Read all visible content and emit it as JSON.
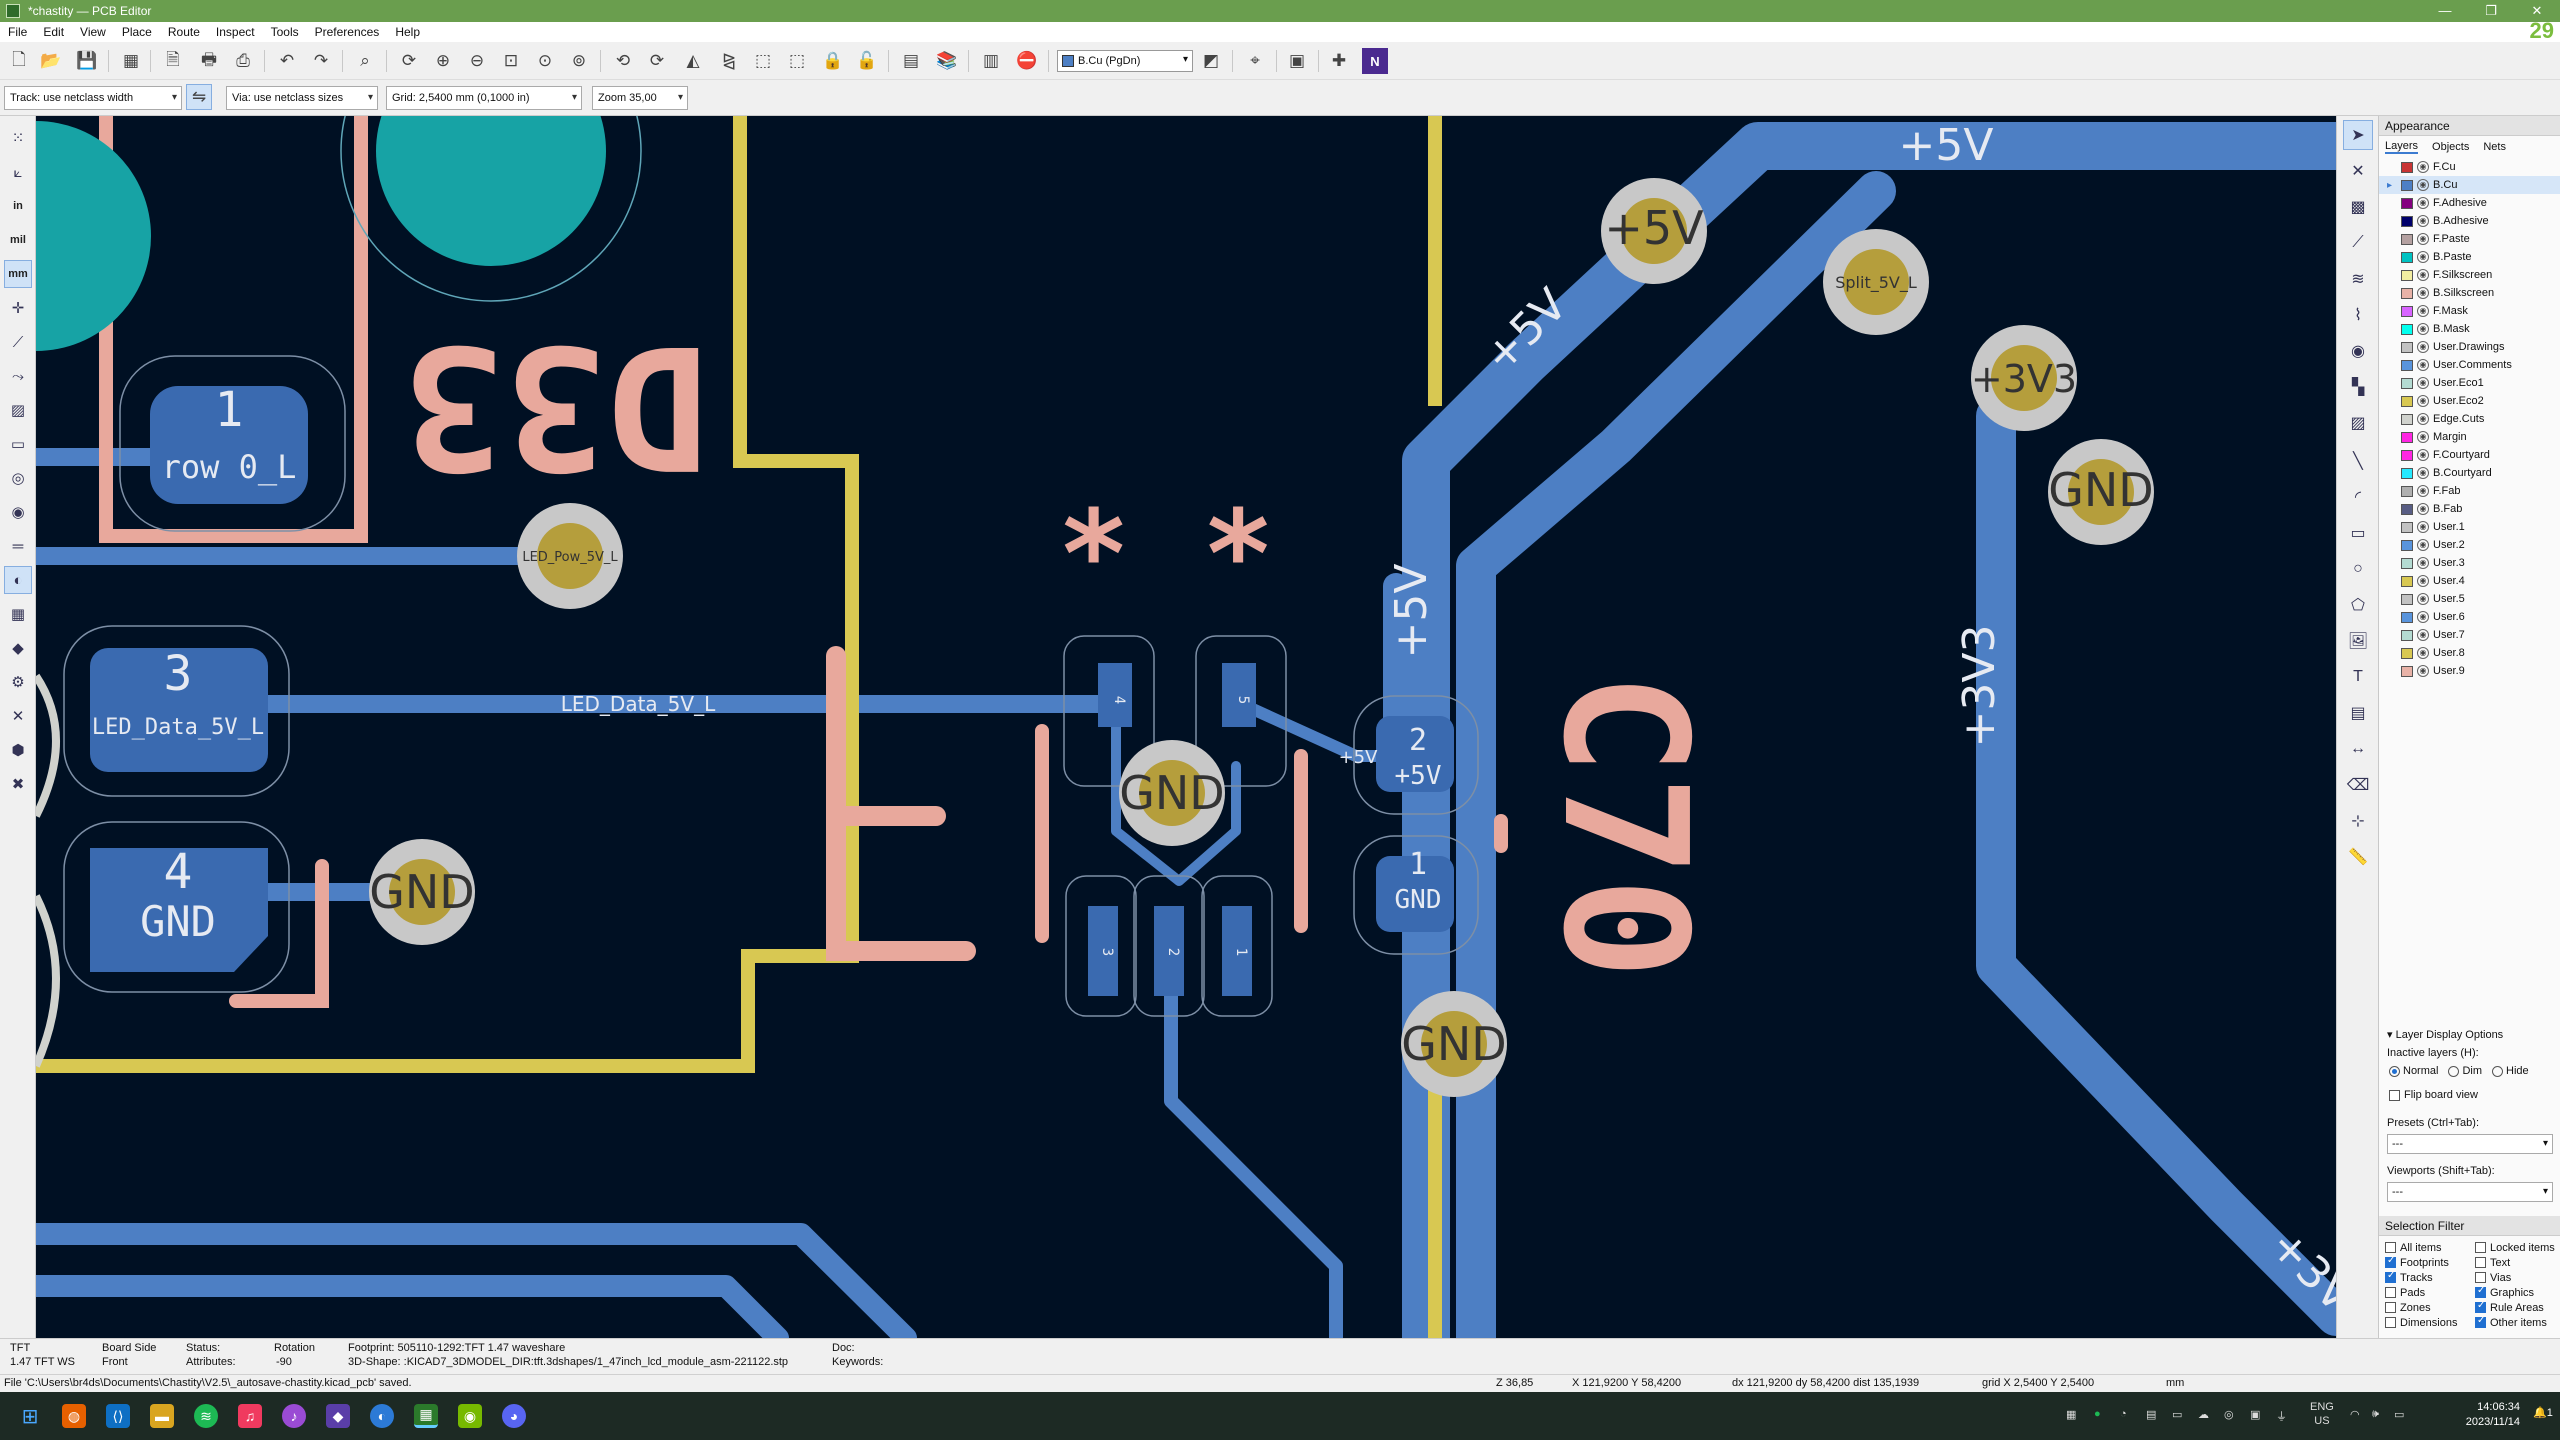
{
  "window": {
    "title": "*chastity — PCB Editor",
    "controls": [
      "—",
      "❐",
      "✕"
    ]
  },
  "menu": [
    "File",
    "Edit",
    "View",
    "Place",
    "Route",
    "Inspect",
    "Tools",
    "Preferences",
    "Help"
  ],
  "toolbar": {
    "active_layer": "B.Cu (PgDn)"
  },
  "options_bar": {
    "track": "Track: use netclass width",
    "via": "Via: use netclass sizes",
    "grid": "Grid: 2,5400 mm (0,1000 in)",
    "zoom": "Zoom 35,00"
  },
  "left_toolbar": {
    "unit_in": "in",
    "unit_mil": "mil",
    "unit_mm": "mm"
  },
  "board": {
    "nets": {
      "plus5v": "+5V",
      "gnd": "GND",
      "plus3v3": "+3V3",
      "split_5v_l": "Split_5V_L",
      "led_pow_5v_l": "LED_Pow_5V_L",
      "led_data_5v_l": "LED_Data_5V_L"
    },
    "pads": {
      "p1_num": "1",
      "p1_net": "row 0_L",
      "p3_num": "3",
      "p3_net": "LED_Data_5V_L",
      "p4_num": "4",
      "p4_net": "GND",
      "c_pad2_num": "2",
      "c_pad2_net": "+5V",
      "c_pad1_num": "1",
      "c_pad1_net": "GND",
      "q_pad4": "4",
      "q_pad5": "5",
      "q_pad1": "1",
      "q_pad2": "2",
      "q_pad3": "3",
      "q_pad4_net": "LED_Data_5V_L",
      "q_pad5_net": "+5V",
      "q_pad1_net": "GND",
      "q_pad2_net": "LED_Data_5V_L",
      "q_pad3_net": "GND"
    },
    "silk": {
      "d33_text": "D33",
      "c_text": "C70",
      "star_text": "* *"
    },
    "track_labels": {
      "plus5v_top": "+5V",
      "plus5v_diag": "+5V",
      "plus5v_vert": "+5V",
      "plus3v3_vert": "+3V3",
      "plus3v_corner": "+3V",
      "plus5v_small": "+5V"
    },
    "corner_number": "29"
  },
  "appearance": {
    "panel_title": "Appearance",
    "tabs": [
      "Layers",
      "Objects",
      "Nets"
    ],
    "layers": [
      {
        "name": "F.Cu",
        "color": "#c83434"
      },
      {
        "name": "B.Cu",
        "color": "#4d7fc4"
      },
      {
        "name": "F.Adhesive",
        "color": "#84007f"
      },
      {
        "name": "B.Adhesive",
        "color": "#00006b"
      },
      {
        "name": "F.Paste",
        "color": "#b4a0a0"
      },
      {
        "name": "B.Paste",
        "color": "#00c2c2"
      },
      {
        "name": "F.Silkscreen",
        "color": "#f2eda1"
      },
      {
        "name": "B.Silkscreen",
        "color": "#e8b2a7"
      },
      {
        "name": "F.Mask",
        "color": "#d864ff"
      },
      {
        "name": "B.Mask",
        "color": "#02ffee"
      },
      {
        "name": "User.Drawings",
        "color": "#c2c2c2"
      },
      {
        "name": "User.Comments",
        "color": "#5994dc"
      },
      {
        "name": "User.Eco1",
        "color": "#b4dbd2"
      },
      {
        "name": "User.Eco2",
        "color": "#d8c852"
      },
      {
        "name": "Edge.Cuts",
        "color": "#d0d2cd"
      },
      {
        "name": "Margin",
        "color": "#ff26e2"
      },
      {
        "name": "F.Courtyard",
        "color": "#ff26e2"
      },
      {
        "name": "B.Courtyard",
        "color": "#26e9ff"
      },
      {
        "name": "F.Fab",
        "color": "#afafaf"
      },
      {
        "name": "B.Fab",
        "color": "#585d84"
      },
      {
        "name": "User.1",
        "color": "#c2c2c2"
      },
      {
        "name": "User.2",
        "color": "#5994dc"
      },
      {
        "name": "User.3",
        "color": "#b4dbd2"
      },
      {
        "name": "User.4",
        "color": "#d8c852"
      },
      {
        "name": "User.5",
        "color": "#c2c2c2"
      },
      {
        "name": "User.6",
        "color": "#5994dc"
      },
      {
        "name": "User.7",
        "color": "#b4dbd2"
      },
      {
        "name": "User.8",
        "color": "#d8c852"
      },
      {
        "name": "User.9",
        "color": "#e8b2a7"
      }
    ],
    "layer_display_options": "Layer Display Options",
    "inactive_layers_label": "Inactive layers (H):",
    "inactive_normal": "Normal",
    "inactive_dim": "Dim",
    "inactive_hide": "Hide",
    "flip_board": "Flip board view",
    "presets_label": "Presets (Ctrl+Tab):",
    "presets_value": "---",
    "viewports_label": "Viewports (Shift+Tab):",
    "viewports_value": "---",
    "selection_filter_title": "Selection Filter",
    "selection_filter": [
      {
        "label": "All items",
        "checked": false
      },
      {
        "label": "Locked items",
        "checked": false
      },
      {
        "label": "Footprints",
        "checked": true
      },
      {
        "label": "Text",
        "checked": false
      },
      {
        "label": "Tracks",
        "checked": true
      },
      {
        "label": "Vias",
        "checked": false
      },
      {
        "label": "Pads",
        "checked": false
      },
      {
        "label": "Graphics",
        "checked": true
      },
      {
        "label": "Zones",
        "checked": false
      },
      {
        "label": "Rule Areas",
        "checked": true
      },
      {
        "label": "Dimensions",
        "checked": false
      },
      {
        "label": "Other items",
        "checked": true
      }
    ]
  },
  "message_panel": {
    "ref": "TFT",
    "value": "1.47 TFT WS",
    "board_side_label": "Board Side",
    "board_side_value": "Front",
    "status_label": "Status:",
    "attributes_label": "Attributes:",
    "rotation_label": "Rotation",
    "rotation_value": "-90",
    "footprint": "Footprint: 505110-1292:TFT 1.47 waveshare",
    "shape": "3D-Shape: :KICAD7_3DMODEL_DIR:tft.3dshapes/1_47inch_lcd_module_asm-221122.stp",
    "doc_label": "Doc:",
    "keywords_label": "Keywords:"
  },
  "status_bar": {
    "message": "File 'C:\\Users\\br4ds\\Documents\\Chastity\\V2.5\\_autosave-chastity.kicad_pcb' saved.",
    "zoom": "Z 36,85",
    "xy": "X 121,9200  Y 58,4200",
    "dxdy": "dx 121,9200  dy 58,4200  dist 135,1939",
    "grid": "grid X 2,5400  Y 2,5400",
    "units": "mm"
  },
  "taskbar": {
    "lang": "ENG",
    "region": "US",
    "time": "14:06:34",
    "date": "2023/11/14",
    "notif": "1"
  }
}
